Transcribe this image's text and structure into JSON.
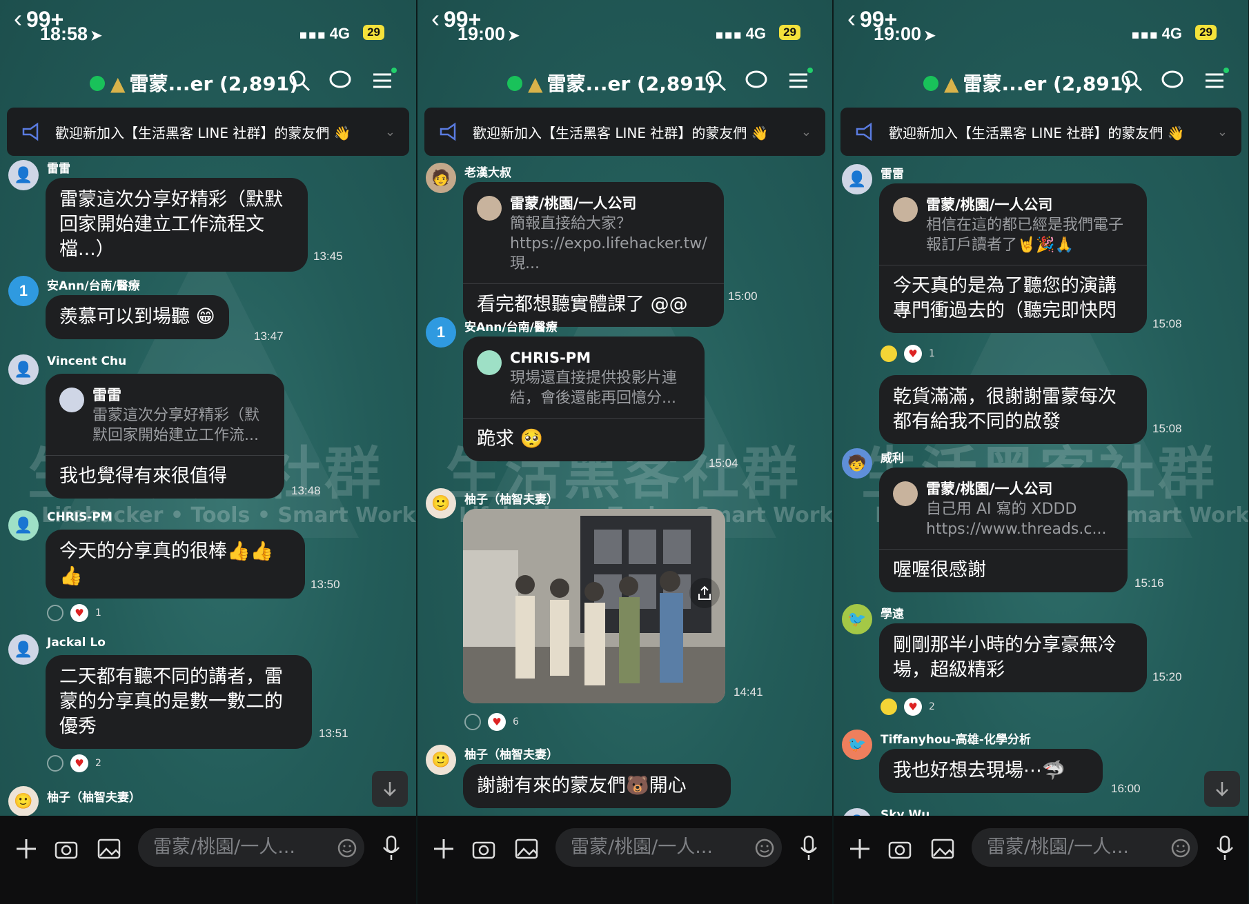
{
  "colors": {
    "accent": "#19c25a",
    "bubble": "#1e1f21",
    "background": "#235c59",
    "battery": "#f4e23b"
  },
  "common": {
    "back_count": "99+",
    "group_title": "雷蒙...er (2,891)",
    "network": "4G",
    "battery": "29",
    "announcement": "歡迎新加入【生活黑客 LINE 社群】的蒙友們 👋",
    "input_placeholder": "雷蒙/桃園/一人...",
    "bg_big": "生活黑客社群",
    "bg_small": "Lifehacker • Tools • Smart Work"
  },
  "panels": [
    {
      "time": "18:58",
      "messages": [
        {
          "sender": "雷雷",
          "text": "雷蒙這次分享好精彩（默默回家開始建立工作流程文檔...）",
          "time": "13:45"
        },
        {
          "sender": "安Ann/台南/醫療",
          "text": "羨慕可以到場聽 😁",
          "time": "13:47"
        },
        {
          "sender": "Vincent Chu",
          "quote_name": "雷雷",
          "quote_text": "雷蒙這次分享好精彩（默默回家開始建立工作流...",
          "text": "我也覺得有來很值得",
          "time": "13:48"
        },
        {
          "sender": "CHRIS-PM",
          "text": "今天的分享真的很棒👍👍👍",
          "time": "13:50",
          "reaction_count": "1"
        },
        {
          "sender": "Jackal Lo",
          "text": "二天都有聽不同的講者，雷蒙的分享真的是數一數二的優秀",
          "time": "13:51",
          "reaction_count": "2"
        },
        {
          "sender": "柚子（柚智夫妻）"
        }
      ]
    },
    {
      "time": "19:00",
      "messages": [
        {
          "sender": "老漢大叔",
          "quote_name": "雷蒙/桃園/一人公司",
          "quote_text": "簡報直接給大家？ https://expo.lifehacker.tw/ 現...",
          "text": "看完都想聽實體課了 @@",
          "time": "15:00"
        },
        {
          "sender": "安Ann/台南/醫療",
          "quote_name": "CHRIS-PM",
          "quote_text": "現場還直接提供投影片連結，會後還能再回憶分...",
          "text": "跪求 🥺",
          "time": "15:04"
        },
        {
          "sender": "柚子（柚智夫妻）",
          "time": "14:41",
          "reaction_count": "6"
        },
        {
          "sender": "柚子（柚智夫妻）",
          "text": "謝謝有來的蒙友們🐻開心"
        }
      ]
    },
    {
      "time": "19:00",
      "messages": [
        {
          "sender": "雷雷",
          "quote_name": "雷蒙/桃園/一人公司",
          "quote_text": "相信在這的都已經是我們電子報訂戶讀者了🤘🎉🙏",
          "text": "今天真的是為了聽您的演講專門衝過去的（聽完即快閃",
          "time": "15:08",
          "reaction_count": "1"
        },
        {
          "text": "乾貨滿滿，很謝謝雷蒙每次都有給我不同的啟發",
          "time": "15:08"
        },
        {
          "sender": "威利",
          "quote_name": "雷蒙/桃園/一人公司",
          "quote_text": "自己用 AI 寫的 XDDD https://www.threads.c...",
          "text": "喔喔很感謝",
          "time": "15:16"
        },
        {
          "sender": "學遠",
          "text": "剛剛那半小時的分享豪無冷場，超級精彩",
          "time": "15:20",
          "reaction_count": "2"
        },
        {
          "sender": "Tiffanyhou-高雄-化學分析",
          "text": "我也好想去現場⋯🦈",
          "time": "16:00"
        },
        {
          "sender": "Sky Wu"
        }
      ]
    }
  ]
}
